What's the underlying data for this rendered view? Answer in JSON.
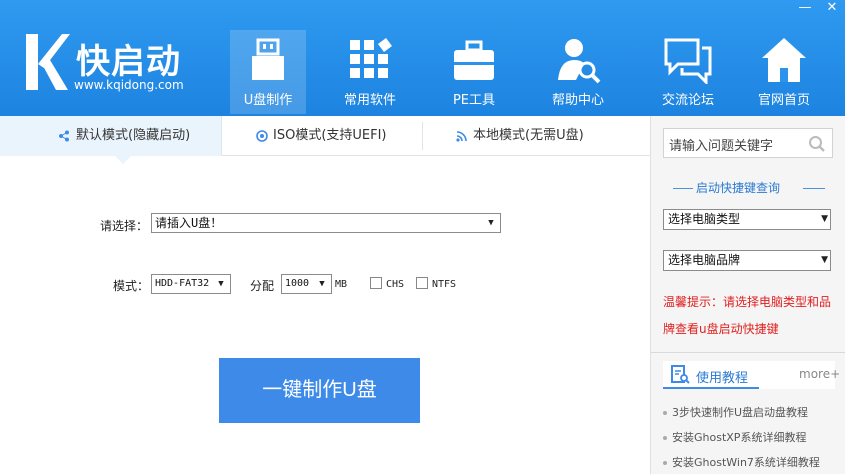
{
  "window": {
    "minimize": "—",
    "close": "✕"
  },
  "logo": {
    "name": "快启动",
    "url": "www.kqidong.com"
  },
  "nav": [
    {
      "label": "U盘制作",
      "icon": "usb-drive-icon",
      "active": true
    },
    {
      "label": "常用软件",
      "icon": "apps-grid-icon",
      "active": false
    },
    {
      "label": "PE工具",
      "icon": "toolbox-icon",
      "active": false
    },
    {
      "label": "帮助中心",
      "icon": "user-search-icon",
      "active": false
    },
    {
      "label": "交流论坛",
      "icon": "chat-bubbles-icon",
      "active": false
    },
    {
      "label": "官网首页",
      "icon": "home-icon",
      "active": false
    }
  ],
  "tabs": [
    {
      "label": "默认模式(隐藏启动)",
      "icon": "share-icon"
    },
    {
      "label": "ISO模式(支持UEFI)",
      "icon": "disc-icon"
    },
    {
      "label": "本地模式(无需U盘)",
      "icon": "rss-icon"
    }
  ],
  "main": {
    "select_label": "请选择：",
    "select_value": "请插入U盘！",
    "mode_label": "模式：",
    "mode_value": "HDD-FAT32",
    "alloc_label": "分配",
    "alloc_value": "1000",
    "alloc_unit": "MB",
    "chs_label": "CHS",
    "ntfs_label": "NTFS",
    "make_button": "一键制作U盘"
  },
  "right": {
    "search_placeholder": "请输入问题关键字",
    "shortcut_title": "启动快捷键查询",
    "type_select": "选择电脑类型",
    "brand_select": "选择电脑品牌",
    "tip": "温馨提示：请选择电脑类型和品牌查看u盘启动快捷键",
    "tutorial_title": "使用教程",
    "more": "more+",
    "links": [
      "3步快速制作U盘启动盘教程",
      "安装GhostXP系统详细教程",
      "安装GhostWin7系统详细教程"
    ]
  },
  "colors": {
    "header": "#2b93ec",
    "accent": "#3d8ae8",
    "tip": "#e02020"
  }
}
